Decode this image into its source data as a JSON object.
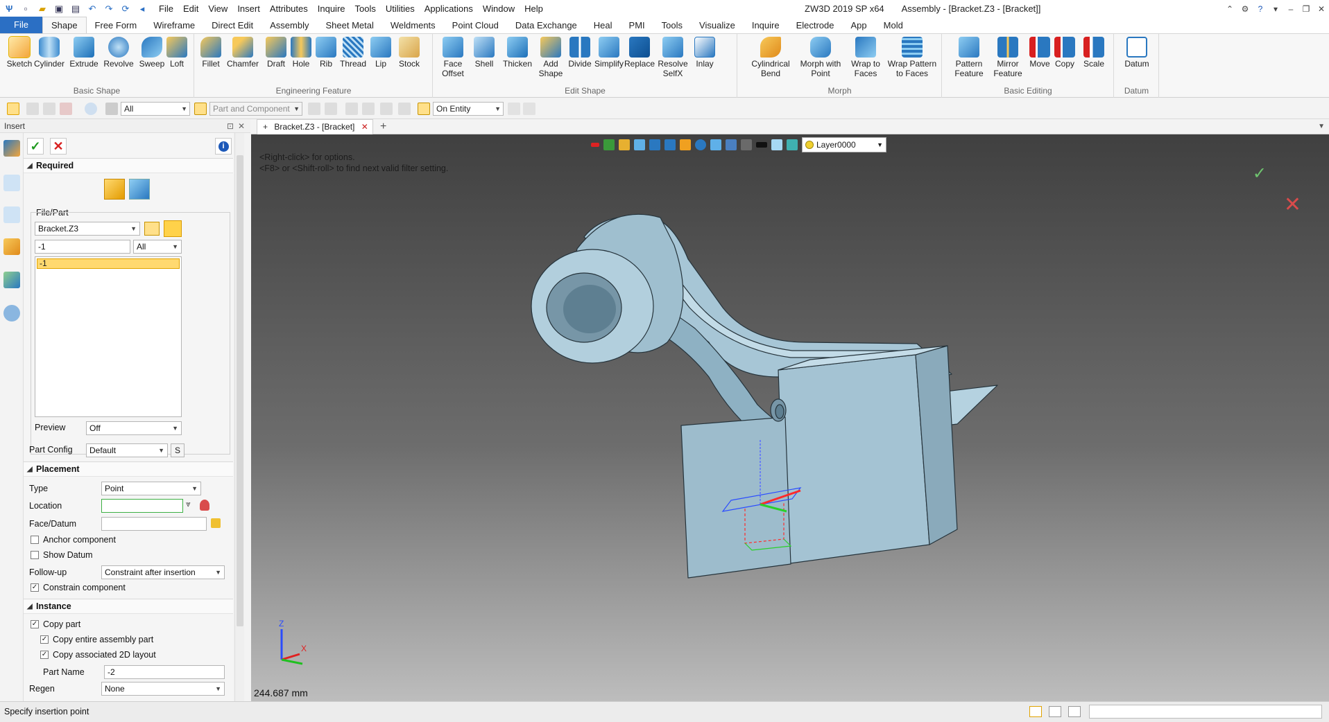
{
  "app": {
    "product": "ZW3D 2019 SP x64",
    "document": "Assembly - [Bracket.Z3 - [Bracket]]"
  },
  "menu": [
    "File",
    "Edit",
    "View",
    "Insert",
    "Attributes",
    "Inquire",
    "Tools",
    "Utilities",
    "Applications",
    "Window",
    "Help"
  ],
  "ribbon_tabs": [
    "File",
    "Shape",
    "Free Form",
    "Wireframe",
    "Direct Edit",
    "Assembly",
    "Sheet Metal",
    "Weldments",
    "Point Cloud",
    "Data Exchange",
    "Heal",
    "PMI",
    "Tools",
    "Visualize",
    "Inquire",
    "Electrode",
    "App",
    "Mold"
  ],
  "ribbon_active_tab": "Shape",
  "ribbon": {
    "basic_shape": {
      "label": "Basic Shape",
      "buttons": [
        "Sketch",
        "Cylinder",
        "Extrude",
        "Revolve",
        "Sweep",
        "Loft"
      ]
    },
    "engineering_feature": {
      "label": "Engineering Feature",
      "buttons": [
        "Fillet",
        "Chamfer",
        "Draft",
        "Hole",
        "Rib",
        "Thread",
        "Lip",
        "Stock"
      ]
    },
    "edit_shape": {
      "label": "Edit Shape",
      "buttons": [
        [
          "Face",
          "Offset"
        ],
        [
          "Shell"
        ],
        [
          "Thicken"
        ],
        [
          "Add",
          "Shape"
        ],
        [
          "Divide"
        ],
        [
          "Simplify"
        ],
        [
          "Replace"
        ],
        [
          "Resolve",
          "SelfX"
        ],
        [
          "Inlay"
        ]
      ]
    },
    "morph": {
      "label": "Morph",
      "buttons": [
        [
          "Cylindrical",
          "Bend"
        ],
        [
          "Morph with",
          "Point"
        ],
        [
          "Wrap to",
          "Faces"
        ],
        [
          "Wrap Pattern",
          "to Faces"
        ]
      ]
    },
    "basic_editing": {
      "label": "Basic Editing",
      "buttons": [
        [
          "Pattern",
          "Feature"
        ],
        [
          "Mirror",
          "Feature"
        ],
        [
          "Move"
        ],
        [
          "Copy"
        ],
        [
          "Scale"
        ]
      ]
    },
    "datum": {
      "label": "Datum",
      "buttons": [
        "Datum"
      ]
    }
  },
  "toolbar2": {
    "filter_all": "All",
    "part_component": "Part and Component",
    "on_entity": "On Entity"
  },
  "panel": {
    "title": "Insert",
    "required": "Required",
    "file_part_label": "File/Part",
    "file": "Bracket.Z3",
    "part_filter": "-1",
    "part_type": "All",
    "list_items": [
      "-1"
    ],
    "preview_label": "Preview",
    "preview_value": "Off",
    "part_config_label": "Part Config",
    "part_config_value": "Default",
    "part_config_btn": "S",
    "placement": "Placement",
    "type_label": "Type",
    "type_value": "Point",
    "location_label": "Location",
    "location_value": "",
    "face_datum_label": "Face/Datum",
    "face_datum_value": "",
    "anchor_component": "Anchor component",
    "show_datum": "Show Datum",
    "followup_label": "Follow-up",
    "followup_value": "Constraint after insertion",
    "constrain_component": "Constrain component",
    "instance": "Instance",
    "copy_part": "Copy part",
    "copy_entire": "Copy entire assembly part",
    "copy_2d": "Copy associated 2D layout",
    "part_name_label": "Part  Name",
    "part_name_value": "-2",
    "regen_label": "Regen",
    "regen_value": "None",
    "checks": {
      "anchor": false,
      "show_datum": false,
      "constrain": true,
      "copy_part": true,
      "copy_entire": true,
      "copy_2d": true
    }
  },
  "doc_tab": "Bracket.Z3 - [Bracket]",
  "viewport": {
    "hint1": "<Right-click> for options.",
    "hint2": "<F8> or <Shift-roll> to find next valid filter setting.",
    "layer": "Layer0000",
    "measure": "244.687 mm",
    "axis_x": "X",
    "axis_y": "Y",
    "axis_z": "Z"
  },
  "status": {
    "message": "Specify insertion point"
  },
  "colors": {
    "part_fill": "#a7c6d6",
    "part_shade": "#7c9fb1",
    "part_edge": "#2a3a44",
    "accent": "#2b6fc4"
  }
}
